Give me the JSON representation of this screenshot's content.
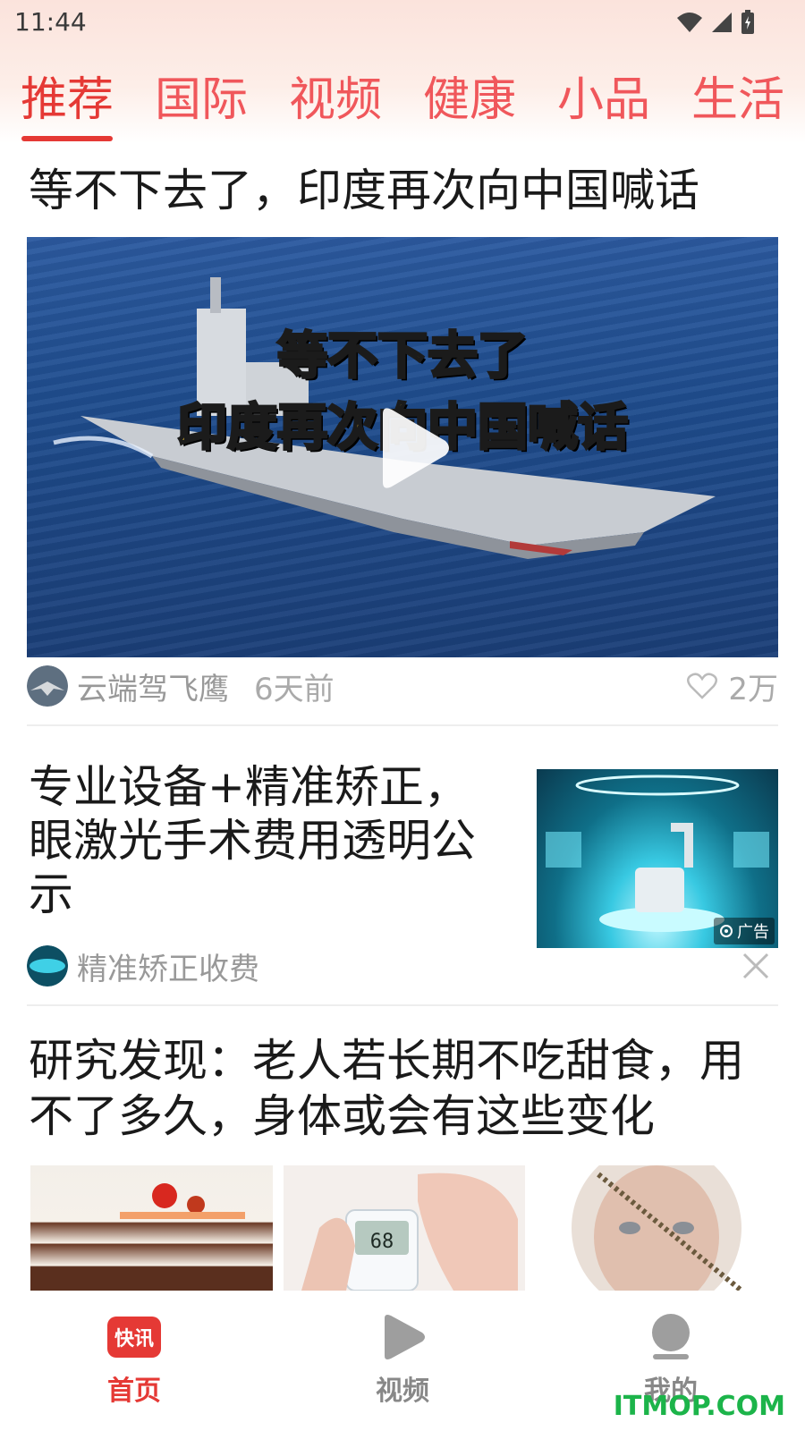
{
  "status_bar": {
    "time": "11:44"
  },
  "tabs": [
    {
      "label": "推荐",
      "active": true
    },
    {
      "label": "国际",
      "active": false
    },
    {
      "label": "视频",
      "active": false
    },
    {
      "label": "健康",
      "active": false
    },
    {
      "label": "小品",
      "active": false
    },
    {
      "label": "生活",
      "active": false
    }
  ],
  "articles": [
    {
      "title": "等不下去了，印度再次向中国喊话",
      "video_overlay_line1": "等不下去了",
      "video_overlay_line2": "印度再次向中国喊话",
      "author": "云端驾飞鹰",
      "time": "6天前",
      "likes": "2万"
    },
    {
      "title": "专业设备+精准矫正，眼激光手术费用透明公示",
      "ad_label": "广告",
      "source": "精准矫正收费"
    },
    {
      "title": "研究发现：老人若长期不吃甜食，用不了多久，身体或会有这些变化",
      "meter_reading": "68"
    }
  ],
  "bottom_nav": [
    {
      "label": "首页",
      "icon_text": "快讯",
      "active": true
    },
    {
      "label": "视频",
      "active": false
    },
    {
      "label": "我的",
      "active": false
    }
  ],
  "watermark": "ITMOP.COM",
  "colors": {
    "accent": "#e53935",
    "tab_inactive": "#f0575b",
    "meta": "#999999"
  }
}
